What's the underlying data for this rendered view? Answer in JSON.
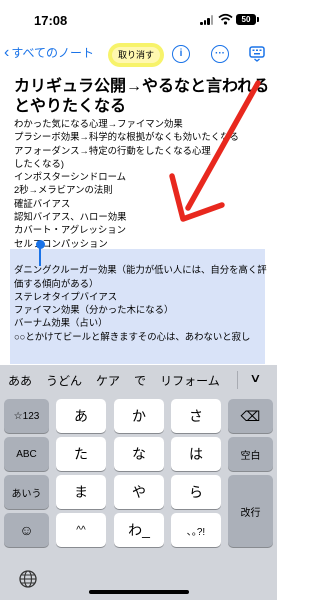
{
  "status_bar": {
    "time": "17:08",
    "battery": "50"
  },
  "nav": {
    "back_label": "すべてのノート",
    "undo_label": "取り消す",
    "info_icon": "info-icon",
    "more_icon": "more-icon",
    "keyboard_icon": "keyboard-dismiss-icon"
  },
  "note": {
    "title": "カリギュラ公開→やるなと言われるとやりたくなる",
    "lines": [
      "わかった気になる心理→ファイマン効果",
      "プラシーボ効果→科学的な根拠がなくも効いたくなる",
      "アフォーダンス→特定の行動をしたくなる心理",
      "したくなる)",
      "インポスターシンドローム",
      "2秒→メラビアンの法則",
      "確証バイアス",
      "認知バイアス、ハロー効果",
      "カバート・アグレッション",
      "セルフコンパッション",
      "",
      "ダニングクルーガー効果（能力が低い人には、自分を高く評価する傾向がある）",
      "ステレオタイプバイアス",
      "ファイマン効果（分かった木になる）",
      "バーナム効果（占い）",
      "○○とかけてビールと解きますその心は、あわないと寂し"
    ]
  },
  "annotation": {
    "arrow_color": "#e8281e",
    "highlight_color": "#f7f36a"
  },
  "keyboard": {
    "candidates": [
      "ああ",
      "うどん",
      "ケア",
      "で",
      "リフォーム"
    ],
    "keys": {
      "num": "☆123",
      "abc": "ABC",
      "aiu": "あいう",
      "a": "あ",
      "ka": "か",
      "sa": "さ",
      "ta": "た",
      "na": "な",
      "ha": "は",
      "ma": "ま",
      "ya": "や",
      "ra": "ら",
      "dakuten": "^^",
      "wa": "わ_",
      "punct": "､｡?!",
      "space": "空白",
      "enter": "改行",
      "delete": "⌫",
      "undo_arrow": "↶",
      "emoji": "☺"
    }
  }
}
